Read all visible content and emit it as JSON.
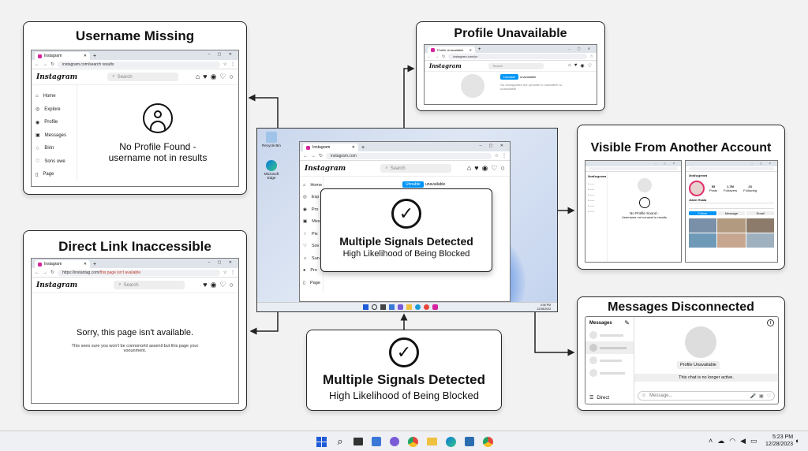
{
  "cards": {
    "username_missing": {
      "title": "Username Missing",
      "tab_label": "Instagram",
      "url": "instagram.com/search results",
      "logo": "Instagram",
      "search_placeholder": "Search",
      "sidebar": [
        "Home",
        "Explore",
        "Profile",
        "Messages",
        "Birin",
        "Sons owe",
        "Page"
      ],
      "message_line1": "No Profile Found -",
      "message_line2": "username not in results"
    },
    "profile_unavailable": {
      "title": "Profile Unavailable",
      "tab_label": "Profile Unavailable",
      "url": "instagram.com/pr",
      "logo": "Instagram",
      "search_placeholder": "Search",
      "btn_primary": "Unnable",
      "btn_secondary": "unavailable",
      "note": "No managolites are penable to unavailble to unavailable"
    },
    "visible_other": {
      "title": "Visible From Another Account",
      "left_logo": "Instagram",
      "left_msg1": "No Profile Sound -",
      "left_msg2": "Username not consest in results",
      "right_logo": "Instagram",
      "stats": [
        {
          "value": "55",
          "label": "Posts"
        },
        {
          "value": "1.7M",
          "label": "Followers"
        },
        {
          "value": "23",
          "label": "Following"
        }
      ],
      "bio_name": "Jiann Hsaia",
      "follow_btn": "Follow",
      "message_btn": "Message",
      "email_btn": "Email"
    },
    "direct_link": {
      "title": "Direct Link Inaccessible",
      "tab_label": "Instagram",
      "url_prefix": "https://instantag.com/",
      "url_warn": "this page isn't available",
      "logo": "Instagram",
      "search_placeholder": "Search",
      "heading": "Sorry, this page isn't available.",
      "sub1": "This sees sure you won't be connonorld assenil but this page your",
      "sub2": "voounment."
    },
    "messages_disconnected": {
      "title": "Messages Disconnected",
      "header": "Messages",
      "badge": "Profile Unavailable",
      "inactive": "This chat is no longer active.",
      "footer_label": "Direct",
      "message_placeholder": "Message..."
    }
  },
  "center": {
    "desktop_icon1": "Recycle Bin",
    "desktop_icon2": "Microsoft Edge",
    "tab_label": "Instagram",
    "url": "instagram.com",
    "logo": "Instagram",
    "search_placeholder": "Search",
    "sidebar": [
      "Home",
      "Exp",
      "Pro",
      "Mes",
      "Pix",
      "Sov",
      "Sun",
      "Pro",
      "Page"
    ],
    "btn1": "Unnable",
    "btn2": "unavailable",
    "panel_title": "Multiple Signals Detected",
    "panel_sub": "High Likelihood of Being Blocked",
    "clock_time": "4:06 PM",
    "clock_date": "12/28/2023"
  },
  "bottom_panel": {
    "title": "Multiple Signals Detected",
    "sub": "High Likelihood of Being Blocked"
  },
  "taskbar": {
    "time": "5:23 PM",
    "date": "12/28/2023"
  },
  "colors": {
    "accent_blue": "#0095f6",
    "instagram_pink": "#d6249f",
    "win_blue": "#1e5bd8"
  }
}
